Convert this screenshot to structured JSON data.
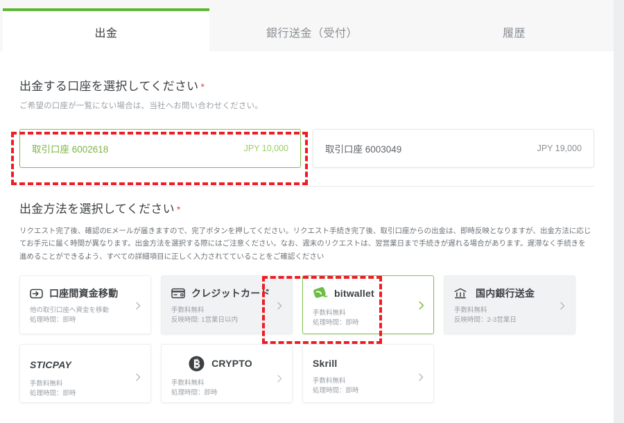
{
  "tabs": [
    {
      "label": "出金",
      "active": true
    },
    {
      "label": "銀行送金（受付）",
      "active": false
    },
    {
      "label": "履歴",
      "active": false
    }
  ],
  "account_section": {
    "title": "出金する口座を選択してください",
    "required_mark": "*",
    "subtitle": "ご希望の口座が一覧にない場合は、当社へお問い合わせください。",
    "accounts": [
      {
        "name": "取引口座 6002618",
        "amount": "JPY 10,000",
        "selected": true
      },
      {
        "name": "取引口座 6003049",
        "amount": "JPY 19,000",
        "selected": false
      }
    ]
  },
  "method_section": {
    "title": "出金方法を選択してください",
    "required_mark": "*",
    "description": "リクエスト完了後、確認のEメールが届きますので、完了ボタンを押してください。リクエスト手続き完了後、取引口座からの出金は、即時反映となりますが、出金方法に応じてお手元に届く時間が異なります。出金方法を選択する際にはご注意ください。なお、週末のリクエストは、翌営業日まで手続きが遅れる場合があります。遅滞なく手続きを進めることができるよう、すべての詳細項目に正しく入力されてていることをご確認ください",
    "methods": [
      {
        "label": "口座間資金移動",
        "icon": "transfer-arrow-icon",
        "line1": "他の取引口座へ資金を移動",
        "line2": "処理時間：即時",
        "style": "white",
        "selected": false
      },
      {
        "label": "クレジットカード",
        "icon": "credit-card-icon",
        "line1": "手数料無料",
        "line2": "反映時間: 1営業日以内",
        "style": "gray",
        "selected": false
      },
      {
        "label": "bitwallet",
        "icon": "bitwallet-logo-icon",
        "line1": "手数料無料",
        "line2": "処理時間：即時",
        "style": "white",
        "selected": true
      },
      {
        "label": "国内銀行送金",
        "icon": "bank-icon",
        "line1": "手数料無料",
        "line2": "反映時間：2-3営業日",
        "style": "gray",
        "selected": false
      },
      {
        "label": "STICPAY",
        "icon": "sticpay-logo-icon",
        "line1": "手数料無料",
        "line2": "処理時間：即時",
        "style": "white",
        "selected": false
      },
      {
        "label": "CRYPTO",
        "icon": "bitcoin-icon",
        "line1": "手数料無料",
        "line2": "処理時間：即時",
        "style": "white",
        "selected": false
      },
      {
        "label": "Skrill",
        "icon": "skrill-logo-icon",
        "line1": "手数料無料",
        "line2": "処理時間：即時",
        "style": "white",
        "selected": false
      }
    ]
  },
  "colors": {
    "accent_green": "#5cb733",
    "annotation_red": "#ee1c25",
    "required_red": "#e2443b",
    "page_bg": "#f4f5f6"
  }
}
